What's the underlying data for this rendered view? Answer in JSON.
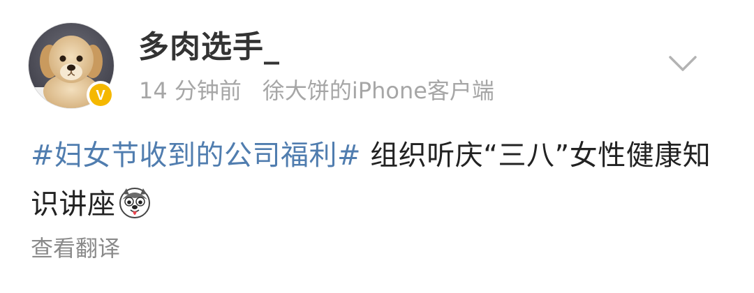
{
  "user": {
    "name": "多肉选手_",
    "avatar": "golden-retriever-puppy-avatar",
    "verified": true
  },
  "meta": {
    "time": "14 分钟前",
    "source": "徐大饼的iPhone客户端"
  },
  "post": {
    "hashtag": "#妇女节收到的公司福利#",
    "text": " 组织听庆“三八”女性健康知识讲座",
    "emoji": "husky-dog-emoji"
  },
  "actions": {
    "translate": "查看翻译",
    "menu_icon": "chevron-down-icon"
  },
  "colors": {
    "hashtag": "#507daf",
    "name": "#333333",
    "meta": "#a6a6a6",
    "badge": "#f5b800"
  }
}
